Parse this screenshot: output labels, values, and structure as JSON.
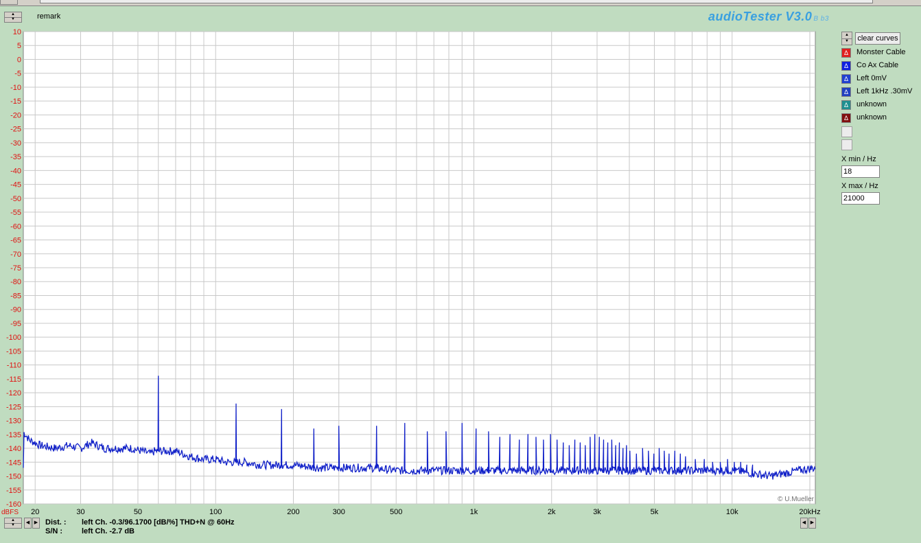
{
  "app": {
    "title": "audioTester V3.0",
    "subversion": "B b3"
  },
  "remark_label": "remark",
  "controls": {
    "clear_curves": "clear curves"
  },
  "legend": [
    {
      "label": "Monster Cable",
      "color": "#e02020",
      "glyph": "Δ"
    },
    {
      "label": "Co Ax Cable",
      "color": "#1020e0",
      "glyph": "Δ"
    },
    {
      "label": "Left 0mV",
      "color": "#2040d0",
      "glyph": "Δ"
    },
    {
      "label": "Left 1kHz .30mV",
      "color": "#2040c0",
      "glyph": "Δ"
    },
    {
      "label": "unknown",
      "color": "#209090",
      "glyph": "Δ"
    },
    {
      "label": "unknown",
      "color": "#801010",
      "glyph": "Δ"
    }
  ],
  "x_range": {
    "min_label": "X min / Hz",
    "min_value": "18",
    "max_label": "X max / Hz",
    "max_value": "21000"
  },
  "status": {
    "dist_label": "Dist. :",
    "dist_value": "left Ch. -0.3/96.1700 [dB/%] THD+N  @ 60Hz",
    "sn_label": "S/N :",
    "sn_value": "left Ch. -2.7 dB"
  },
  "chart_data": {
    "type": "line",
    "xscale": "log",
    "xlim": [
      18,
      21000
    ],
    "ylim": [
      -160,
      10
    ],
    "yunit_label": "dBFS",
    "grid": true,
    "copyright": "© U.Mueller",
    "y_ticks": [
      10,
      5,
      0,
      -5,
      -10,
      -15,
      -20,
      -25,
      -30,
      -35,
      -40,
      -45,
      -50,
      -55,
      -60,
      -65,
      -70,
      -75,
      -80,
      -85,
      -90,
      -95,
      -100,
      -105,
      -110,
      -115,
      -120,
      -125,
      -130,
      -135,
      -140,
      -145,
      -150,
      -155,
      -160
    ],
    "x_ticks": [
      {
        "v": 20,
        "label": "20"
      },
      {
        "v": 30,
        "label": "30"
      },
      {
        "v": 50,
        "label": "50"
      },
      {
        "v": 100,
        "label": "100"
      },
      {
        "v": 200,
        "label": "200"
      },
      {
        "v": 300,
        "label": "300"
      },
      {
        "v": 500,
        "label": "500"
      },
      {
        "v": 1000,
        "label": "1k"
      },
      {
        "v": 2000,
        "label": "2k"
      },
      {
        "v": 3000,
        "label": "3k"
      },
      {
        "v": 5000,
        "label": "5k"
      },
      {
        "v": 10000,
        "label": "10k"
      },
      {
        "v": 20000,
        "label": "20kHz"
      }
    ],
    "series": [
      {
        "color": "#1020c8",
        "baseline": [
          [
            18,
            -134
          ],
          [
            19,
            -137
          ],
          [
            21,
            -139
          ],
          [
            24,
            -140
          ],
          [
            27,
            -139
          ],
          [
            30,
            -140
          ],
          [
            33,
            -138
          ],
          [
            37,
            -140
          ],
          [
            42,
            -140
          ],
          [
            47,
            -140
          ],
          [
            52,
            -141
          ],
          [
            56,
            -142
          ],
          [
            58,
            -141
          ],
          [
            70,
            -141
          ],
          [
            80,
            -143
          ],
          [
            90,
            -144
          ],
          [
            100,
            -144
          ],
          [
            110,
            -145
          ],
          [
            130,
            -145
          ],
          [
            150,
            -146
          ],
          [
            170,
            -146
          ],
          [
            200,
            -146
          ],
          [
            250,
            -147
          ],
          [
            300,
            -147
          ],
          [
            400,
            -147
          ],
          [
            500,
            -148
          ],
          [
            600,
            -148
          ],
          [
            800,
            -148
          ],
          [
            1000,
            -148
          ],
          [
            1500,
            -148
          ],
          [
            2000,
            -148
          ],
          [
            3000,
            -148
          ],
          [
            4000,
            -148
          ],
          [
            5000,
            -148
          ],
          [
            6000,
            -148
          ],
          [
            8000,
            -148
          ],
          [
            10000,
            -148
          ],
          [
            12000,
            -149
          ],
          [
            14000,
            -150
          ],
          [
            16000,
            -149
          ],
          [
            18000,
            -148
          ],
          [
            21000,
            -147
          ]
        ],
        "peaks": [
          [
            60,
            -114
          ],
          [
            120,
            -124
          ],
          [
            180,
            -126
          ],
          [
            240,
            -133
          ],
          [
            300,
            -132
          ],
          [
            420,
            -132
          ],
          [
            540,
            -131
          ],
          [
            660,
            -134
          ],
          [
            780,
            -134
          ],
          [
            900,
            -131
          ],
          [
            1020,
            -133
          ],
          [
            1140,
            -134
          ],
          [
            1260,
            -136
          ],
          [
            1380,
            -135
          ],
          [
            1500,
            -137
          ],
          [
            1620,
            -135
          ],
          [
            1740,
            -136
          ],
          [
            1860,
            -137
          ],
          [
            1980,
            -135
          ],
          [
            2100,
            -137
          ],
          [
            2220,
            -138
          ],
          [
            2340,
            -139
          ],
          [
            2460,
            -137
          ],
          [
            2580,
            -138
          ],
          [
            2700,
            -139
          ],
          [
            2820,
            -136
          ],
          [
            2940,
            -135
          ],
          [
            3060,
            -136
          ],
          [
            3180,
            -137
          ],
          [
            3300,
            -138
          ],
          [
            3420,
            -137
          ],
          [
            3540,
            -139
          ],
          [
            3660,
            -138
          ],
          [
            3780,
            -140
          ],
          [
            3900,
            -139
          ],
          [
            4020,
            -141
          ],
          [
            4260,
            -142
          ],
          [
            4500,
            -140
          ],
          [
            4740,
            -141
          ],
          [
            4980,
            -142
          ],
          [
            5220,
            -140
          ],
          [
            5460,
            -141
          ],
          [
            5700,
            -142
          ],
          [
            6000,
            -141
          ],
          [
            6300,
            -142
          ],
          [
            6600,
            -143
          ],
          [
            7200,
            -144
          ],
          [
            7800,
            -144
          ],
          [
            8400,
            -145
          ],
          [
            9000,
            -145
          ],
          [
            9600,
            -144
          ],
          [
            10200,
            -145
          ],
          [
            10800,
            -145
          ],
          [
            11400,
            -146
          ],
          [
            12000,
            -146
          ]
        ]
      }
    ]
  }
}
